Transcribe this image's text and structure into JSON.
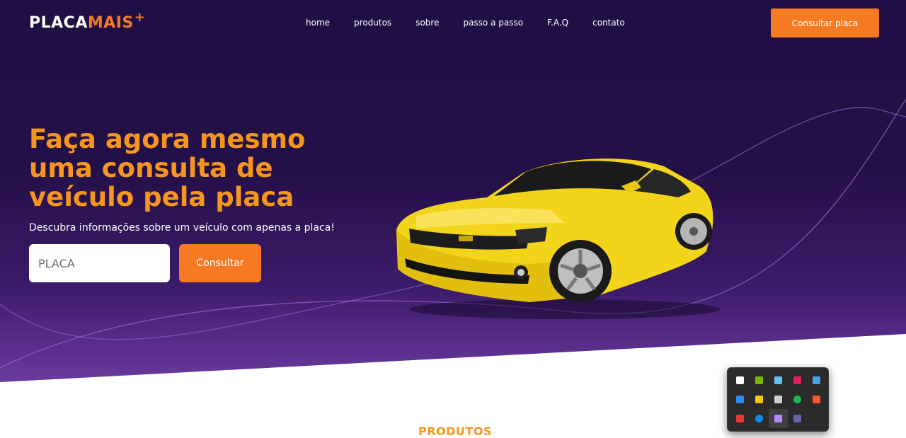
{
  "header": {
    "logo_placa": "PLACA",
    "logo_mais": "MAIS",
    "logo_plus": "+",
    "nav": [
      "home",
      "produtos",
      "sobre",
      "passo a passo",
      "F.A.Q",
      "contato"
    ],
    "cta_label": "Consultar placa"
  },
  "hero": {
    "headline": "Faça agora mesmo uma consulta de veículo pela placa",
    "subheadline": "Descubra informações sobre um veículo com apenas a placa!",
    "input_placeholder": "PLACA",
    "button_label": "Consultar"
  },
  "section": {
    "title": "PRODUTOS"
  },
  "colors": {
    "accent": "#f57a22",
    "headline": "#f7961f",
    "hero_dark": "#1f0f44",
    "hero_light": "#6a3a9e",
    "car_yellow": "#f2d51a"
  },
  "tray": {
    "icons": [
      "security-shield-icon",
      "nvidia-icon",
      "steam-icon",
      "slack-icon",
      "network-drive-icon",
      "bluetooth-icon",
      "onedrive-warning-icon",
      "cloud-sync-icon",
      "spotify-icon",
      "brave-icon",
      "screen-recorder-icon",
      "teamviewer-icon",
      "feather-pen-icon",
      "teams-icon"
    ],
    "icon_colors": [
      "#ffffff",
      "#76b900",
      "#66c0f4",
      "#e01e5a",
      "#4aa3df",
      "#2d8cf0",
      "#f5c518",
      "#d0d0d0",
      "#1db954",
      "#fb542b",
      "#e53935",
      "#0e8ee9",
      "#b388ff",
      "#6264a7"
    ]
  }
}
